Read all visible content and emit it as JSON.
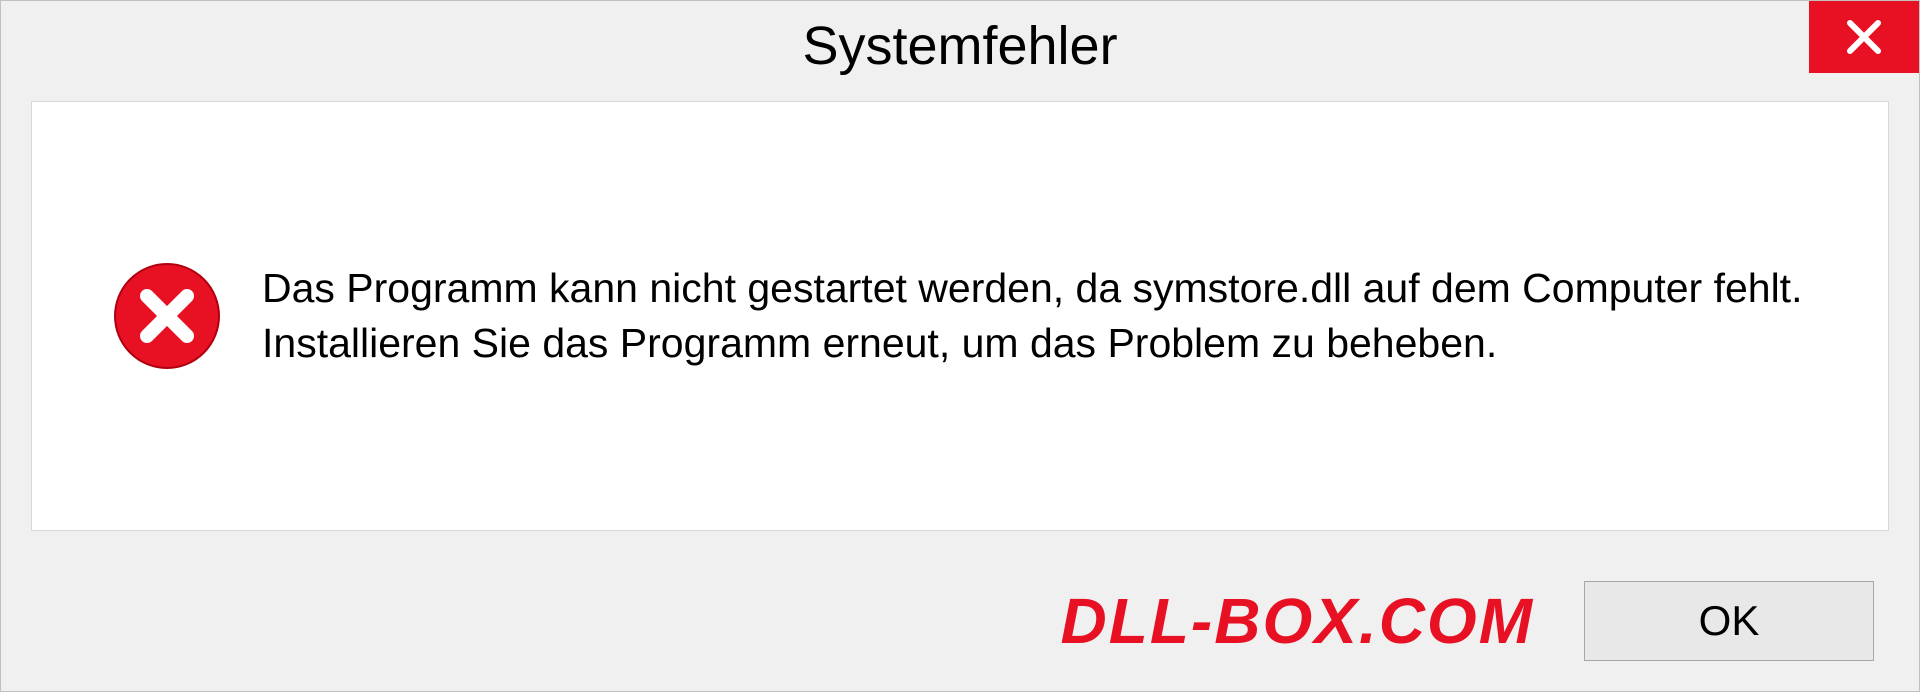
{
  "dialog": {
    "title": "Systemfehler",
    "message": "Das Programm kann nicht gestartet werden, da symstore.dll auf dem Computer fehlt. Installieren Sie das Programm erneut, um das Problem zu beheben.",
    "ok_label": "OK",
    "watermark": "DLL-BOX.COM"
  }
}
